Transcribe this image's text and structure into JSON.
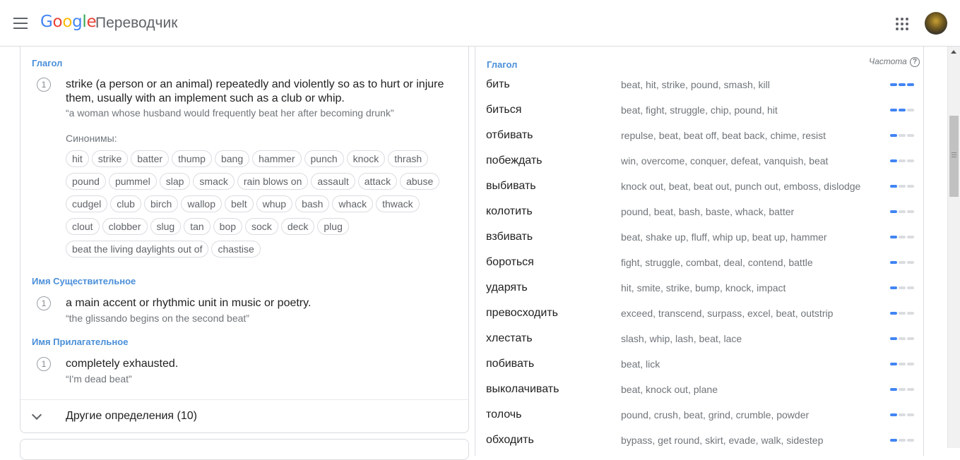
{
  "header": {
    "logo_letters": [
      "G",
      "o",
      "o",
      "g",
      "l",
      "e"
    ],
    "product": "Переводчик"
  },
  "definitions": {
    "verb": {
      "pos": "Глагол",
      "num": "1",
      "text": "strike (a person or an animal) repeatedly and violently so as to hurt or injure them, usually with an implement such as a club or whip.",
      "example": "“a woman whose husband would frequently beat her after becoming drunk”",
      "syn_title": "Синонимы:",
      "synonym_rows": [
        [
          "hit",
          "strike",
          "batter",
          "thump",
          "bang",
          "hammer",
          "punch",
          "knock",
          "thrash"
        ],
        [
          "pound",
          "pummel",
          "slap",
          "smack",
          "rain blows on",
          "assault",
          "attack",
          "abuse"
        ],
        [
          "cudgel",
          "club",
          "birch",
          "wallop",
          "belt",
          "whup",
          "bash",
          "whack",
          "thwack"
        ],
        [
          "clout",
          "clobber",
          "slug",
          "tan",
          "bop",
          "sock",
          "deck",
          "plug"
        ],
        [
          "beat the living daylights out of",
          "chastise"
        ]
      ]
    },
    "noun": {
      "pos": "Имя Существительное",
      "num": "1",
      "text": "a main accent or rhythmic unit in music or poetry.",
      "example": "“the glissando begins on the second beat”"
    },
    "adjective": {
      "pos": "Имя Прилагательное",
      "num": "1",
      "text": "completely exhausted.",
      "example": "“I'm dead beat”"
    },
    "more_label": "Другие определения (10)"
  },
  "translations": {
    "pos": "Глагол",
    "freq_label": "Частота",
    "help_glyph": "?",
    "rows": [
      {
        "word": "бить",
        "syn": "beat, hit, strike, pound, smash, kill",
        "freq": 3
      },
      {
        "word": "биться",
        "syn": "beat, fight, struggle, chip, pound, hit",
        "freq": 2
      },
      {
        "word": "отбивать",
        "syn": "repulse, beat, beat off, beat back, chime, resist",
        "freq": 1
      },
      {
        "word": "побеждать",
        "syn": "win, overcome, conquer, defeat, vanquish, beat",
        "freq": 1
      },
      {
        "word": "выбивать",
        "syn": "knock out, beat, beat out, punch out, emboss, dislodge",
        "freq": 1
      },
      {
        "word": "колотить",
        "syn": "pound, beat, bash, baste, whack, batter",
        "freq": 1
      },
      {
        "word": "взбивать",
        "syn": "beat, shake up, fluff, whip up, beat up, hammer",
        "freq": 1
      },
      {
        "word": "бороться",
        "syn": "fight, struggle, combat, deal, contend, battle",
        "freq": 1
      },
      {
        "word": "ударять",
        "syn": "hit, smite, strike, bump, knock, impact",
        "freq": 1
      },
      {
        "word": "превосходить",
        "syn": "exceed, transcend, surpass, excel, beat, outstrip",
        "freq": 1
      },
      {
        "word": "хлестать",
        "syn": "slash, whip, lash, beat, lace",
        "freq": 1
      },
      {
        "word": "побивать",
        "syn": "beat, lick",
        "freq": 1
      },
      {
        "word": "выколачивать",
        "syn": "beat, knock out, plane",
        "freq": 1
      },
      {
        "word": "толочь",
        "syn": "pound, crush, beat, grind, crumble, powder",
        "freq": 1
      },
      {
        "word": "обходить",
        "syn": "bypass, get round, skirt, evade, walk, sidestep",
        "freq": 1
      }
    ]
  },
  "colors": {
    "accent": "#4285f4",
    "pos_label": "#4a8fd9"
  }
}
